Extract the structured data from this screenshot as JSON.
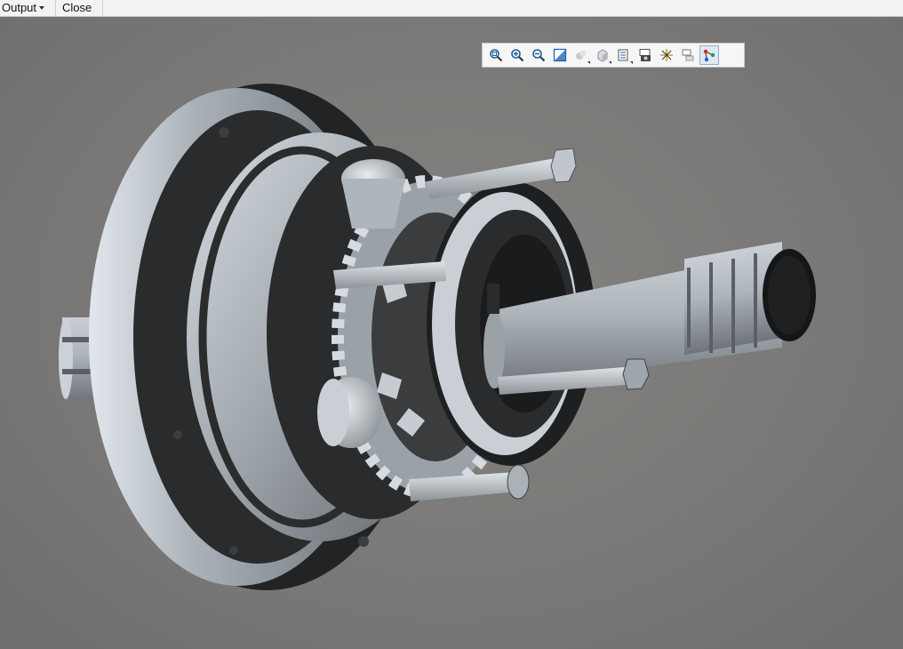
{
  "menubar": {
    "output_label": "Output",
    "close_label": "Close"
  },
  "viewport": {
    "description_icon": "gear-assembly-3d-model"
  },
  "toolbar": {
    "icons": [
      "fit-all-icon",
      "zoom-in-icon",
      "zoom-out-icon",
      "normal-view-icon",
      "rotate-view-icon",
      "view-cube-icon",
      "view-mode-icon",
      "capture-icon",
      "lighting-icon",
      "hide-show-icon",
      "tree-view-icon"
    ]
  },
  "colors": {
    "background": "#7b7a78",
    "metal": "#bfc6cc",
    "dark_metal": "#1c1d1e",
    "toolbar_bg": "#f6f6f6"
  }
}
